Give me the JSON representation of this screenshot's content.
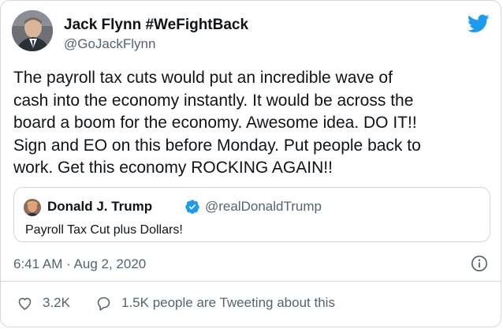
{
  "author": {
    "name": "Jack Flynn #WeFightBack",
    "handle": "@GoJackFlynn"
  },
  "tweet": {
    "lines": [
      "The payroll tax cuts would put an incredible wave of",
      "cash into the economy instantly. It would be across the",
      "board a boom for the economy. Awesome idea. DO IT!!",
      "Sign and EO on this before Monday. Put people back to",
      "work. Get this economy ROCKING AGAIN!!"
    ]
  },
  "quoted_tweet": {
    "name": "Donald J. Trump",
    "handle": "@realDonaldTrump",
    "text": "Payroll Tax Cut plus Dollars!",
    "verified": true
  },
  "timestamp": "6:41 AM · Aug 2, 2020",
  "actions": {
    "likes": "3.2K",
    "replies_text": "1.5K people are Tweeting about this"
  },
  "colors": {
    "twitter_blue": "#1d9bf0",
    "secondary_text": "#536471",
    "border": "#cfd9de"
  },
  "icons": [
    "twitter-bird-icon",
    "verified-badge-icon",
    "info-icon",
    "heart-icon",
    "reply-bubble-icon"
  ]
}
